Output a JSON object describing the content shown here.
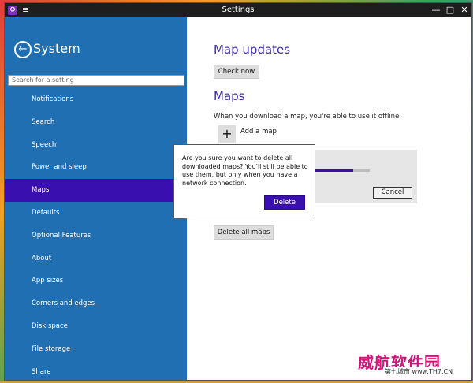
{
  "window": {
    "title": "Settings",
    "app_icon": "gear-icon",
    "menu_icon": "hamburger-icon",
    "controls": [
      "—",
      "□",
      "✕"
    ]
  },
  "sidebar": {
    "back_icon": "back-arrow-icon",
    "title": "System",
    "search_placeholder": "Search for a setting",
    "items": [
      {
        "label": "Notifications"
      },
      {
        "label": "Search"
      },
      {
        "label": "Speech"
      },
      {
        "label": "Power and sleep"
      },
      {
        "label": "Maps",
        "selected": true
      },
      {
        "label": "Defaults"
      },
      {
        "label": "Optional Features"
      },
      {
        "label": "About"
      },
      {
        "label": "App sizes"
      },
      {
        "label": "Corners and edges"
      },
      {
        "label": "Disk space"
      },
      {
        "label": "File storage"
      },
      {
        "label": "Share"
      }
    ]
  },
  "main": {
    "map_updates_heading": "Map updates",
    "check_now_label": "Check now",
    "maps_heading": "Maps",
    "maps_description": "When you download a map, you're able to use it offline.",
    "add_map_label": "Add a map",
    "download_progress": 0.7,
    "cancel_label": "Cancel",
    "delete_all_label": "Delete all maps"
  },
  "dialog": {
    "message": "Are you sure you want to delete all downloaded maps? You'll still be able to use them, but only when you have a network connection.",
    "delete_label": "Delete"
  },
  "watermark": {
    "text": "威航软件园",
    "sub": "第七城市 www.TH7.CN"
  },
  "colors": {
    "sidebar_bg": "#1f6fb2",
    "accent": "#3a0fb0",
    "heading": "#3b2aa8",
    "titlebar": "#1e1e1e"
  }
}
